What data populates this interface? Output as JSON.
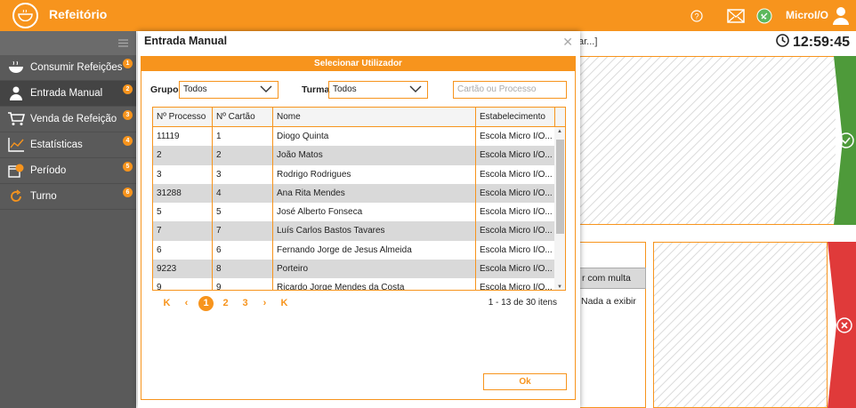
{
  "app": {
    "title": "Refeitório",
    "user_name": "MicroI/O"
  },
  "sidebar": {
    "items": [
      {
        "label": "Consumir Refeições",
        "badge": "1",
        "icon": "bowl-icon"
      },
      {
        "label": "Entrada Manual",
        "badge": "2",
        "icon": "person-icon"
      },
      {
        "label": "Venda de Refeição",
        "badge": "3",
        "icon": "cart-icon"
      },
      {
        "label": "Estatísticas",
        "badge": "4",
        "icon": "chart-icon"
      },
      {
        "label": "Período",
        "badge": "5",
        "icon": "calendar-clock-icon"
      },
      {
        "label": "Turno",
        "badge": "6",
        "icon": "refresh-icon"
      }
    ]
  },
  "background": {
    "clock": "12:59:45",
    "search_fragment": "ar...]",
    "multa_label": "r com multa",
    "empty_label": "Nada a exibir"
  },
  "modal": {
    "title": "Entrada Manual",
    "inner_title": "Selecionar Utilizador",
    "grupo_label": "Grupo",
    "grupo_value": "Todos",
    "turma_label": "Turma",
    "turma_value": "Todos",
    "search_placeholder": "Cartão ou Processo",
    "columns": [
      "Nº Processo",
      "Nº Cartão",
      "Nome",
      "Estabelecimento"
    ],
    "rows": [
      [
        "11119",
        "1",
        "Diogo Quinta",
        "Escola Micro I/O..."
      ],
      [
        "2",
        "2",
        "João Matos",
        "Escola Micro I/O..."
      ],
      [
        "3",
        "3",
        "Rodrigo Rodrigues",
        "Escola Micro I/O..."
      ],
      [
        "31288",
        "4",
        "Ana Rita Mendes",
        "Escola Micro I/O..."
      ],
      [
        "5",
        "5",
        "José Alberto Fonseca",
        "Escola Micro I/O..."
      ],
      [
        "7",
        "7",
        "Luís Carlos Bastos Tavares",
        "Escola Micro I/O..."
      ],
      [
        "6",
        "6",
        "Fernando Jorge de Jesus Almeida",
        "Escola Micro I/O..."
      ],
      [
        "9223",
        "8",
        "Porteiro",
        "Escola Micro I/O..."
      ],
      [
        "9",
        "9",
        "Ricardo Jorge Mendes da Costa",
        "Escola Micro I/O..."
      ]
    ],
    "pages": [
      "1",
      "2",
      "3"
    ],
    "active_page": "1",
    "pager_info": "1 - 13 de 30 itens",
    "ok_label": "Ok"
  },
  "colors": {
    "accent": "#f7941d",
    "sidebar": "#5a5a5a",
    "ok_green": "#4e9a3a",
    "cancel_red": "#e03a3a"
  }
}
